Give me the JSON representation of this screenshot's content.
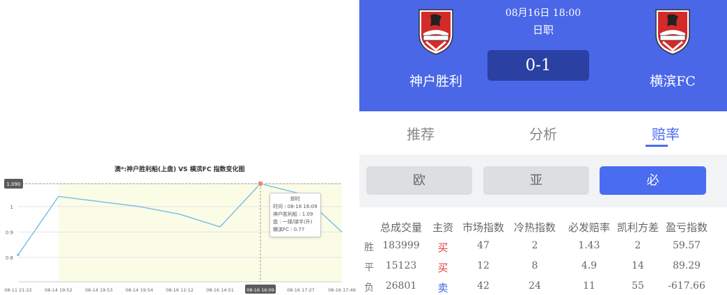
{
  "chart_data": {
    "type": "line",
    "title": "澳*:神户胜利船(上盘) VS 横滨FC 指数变化图",
    "x": [
      "08-11 21:22",
      "08-14 19:52",
      "08-14 19:53",
      "08-14 19:54",
      "08-16 11:12",
      "08-16 14:51",
      "08-16 16:09",
      "08-16 17:27",
      "08-16 17:49"
    ],
    "values": [
      0.81,
      1.04,
      1.02,
      1.0,
      0.97,
      0.92,
      1.09,
      1.05,
      0.9
    ],
    "y_ticks": [
      "1.090",
      "1",
      "0.9",
      "0.8"
    ],
    "ylim": [
      0.8,
      1.09
    ],
    "highlighted_point": "08-16 16:09",
    "highlighted_y": "1.090",
    "grid": true,
    "tooltip": {
      "title": "即时",
      "lines": [
        "时间 : 08-16 16:09",
        "神户胜利船 : 1.09",
        "盘 : 一球/球半(升)",
        "横滨FC : 0.77"
      ]
    }
  },
  "match": {
    "home_team": "神户胜利",
    "away_team": "横滨FC",
    "time": "08月16日 18:00",
    "league": "日职",
    "score": "0-1"
  },
  "tabs": [
    "推荐",
    "分析",
    "赔率"
  ],
  "active_tab": "赔率",
  "segments": [
    "欧",
    "亚",
    "必"
  ],
  "active_segment": "必",
  "table": {
    "headers": [
      "总成交量",
      "主资",
      "市场指数",
      "冷热指数",
      "必发赔率",
      "凯利方差",
      "盈亏指数"
    ],
    "rows": [
      {
        "label": "胜",
        "cells": [
          "183999",
          "买",
          "47",
          "2",
          "1.43",
          "2",
          "59.57"
        ]
      },
      {
        "label": "平",
        "cells": [
          "15123",
          "买",
          "12",
          "8",
          "4.9",
          "14",
          "89.29"
        ]
      },
      {
        "label": "负",
        "cells": [
          "26801",
          "卖",
          "42",
          "24",
          "11",
          "55",
          "-617.66"
        ]
      }
    ]
  },
  "colors": {
    "header_bg": "#4a67e8",
    "accent": "#4a6cf0",
    "buy": "#e23b3b",
    "sell": "#3a64d8",
    "chart_line": "#7cc0ea",
    "chart_fill": "#fbfce6"
  }
}
